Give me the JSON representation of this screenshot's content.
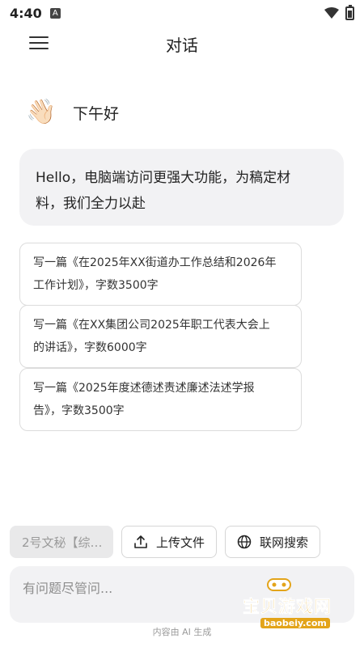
{
  "status_bar": {
    "time": "4:40",
    "notif_letter": "A"
  },
  "header": {
    "title": "对话"
  },
  "greeting": {
    "emoji": "👋🏻",
    "text": "下午好"
  },
  "intro": {
    "line1": "Hello，电脑端访问更强大功能，为稿定材",
    "line2": "料，我们全力以赴"
  },
  "suggestions": [
    {
      "line1": "写一篇《在2025年XX街道办工作总结和2026年",
      "line2": "工作计划》，字数3500字"
    },
    {
      "line1": "写一篇《在XX集团公司2025年职工代表大会上",
      "line2": "的讲话》，字数6000字"
    },
    {
      "line1": "写一篇《2025年度述德述责述廉述法述学报",
      "line2": "告》，字数3500字"
    }
  ],
  "toolbar": {
    "model_label": "2号文秘【综…",
    "upload_label": "上传文件",
    "search_label": "联网搜索"
  },
  "input": {
    "placeholder": "有问题尽管问..."
  },
  "footer": {
    "note": "内容由 AI 生成"
  },
  "watermark": {
    "text": "宝贝游戏网",
    "domain": "baobeiy.com"
  },
  "colors": {
    "bubble_bg": "#f2f2f4",
    "model_chip_bg": "#e9e9ea",
    "watermark": "#e3a41a"
  }
}
